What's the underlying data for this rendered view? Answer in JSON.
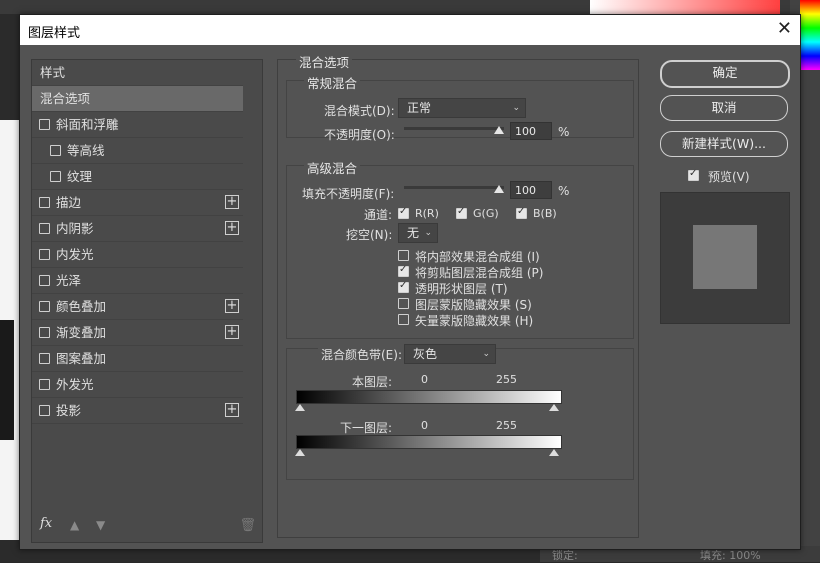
{
  "dialog": {
    "title": "图层样式",
    "close_icon": "close-icon"
  },
  "styles_list": {
    "items": [
      {
        "label": "样式",
        "checkbox": false,
        "plus": false,
        "selected": false
      },
      {
        "label": "混合选项",
        "checkbox": false,
        "plus": false,
        "selected": true
      },
      {
        "label": "斜面和浮雕",
        "checkbox": true,
        "plus": false,
        "selected": false
      },
      {
        "label": "等高线",
        "checkbox": true,
        "plus": false,
        "selected": false,
        "indent": true
      },
      {
        "label": "纹理",
        "checkbox": true,
        "plus": false,
        "selected": false,
        "indent": true
      },
      {
        "label": "描边",
        "checkbox": true,
        "plus": true,
        "selected": false
      },
      {
        "label": "内阴影",
        "checkbox": true,
        "plus": true,
        "selected": false
      },
      {
        "label": "内发光",
        "checkbox": true,
        "plus": false,
        "selected": false
      },
      {
        "label": "光泽",
        "checkbox": true,
        "plus": false,
        "selected": false
      },
      {
        "label": "颜色叠加",
        "checkbox": true,
        "plus": true,
        "selected": false
      },
      {
        "label": "渐变叠加",
        "checkbox": true,
        "plus": true,
        "selected": false
      },
      {
        "label": "图案叠加",
        "checkbox": true,
        "plus": false,
        "selected": false
      },
      {
        "label": "外发光",
        "checkbox": true,
        "plus": false,
        "selected": false
      },
      {
        "label": "投影",
        "checkbox": true,
        "plus": true,
        "selected": false
      }
    ],
    "fx_label": "fx"
  },
  "blend_options": {
    "section_title": "混合选项",
    "general": {
      "title": "常规混合",
      "blend_mode_label": "混合模式(D):",
      "blend_mode_value": "正常",
      "opacity_label": "不透明度(O):",
      "opacity_value": "100",
      "opacity_unit": "%"
    },
    "advanced": {
      "title": "高级混合",
      "fill_opacity_label": "填充不透明度(F):",
      "fill_opacity_value": "100",
      "fill_opacity_unit": "%",
      "channels_label": "通道:",
      "channels": [
        {
          "label": "R(R)",
          "checked": true
        },
        {
          "label": "G(G)",
          "checked": true
        },
        {
          "label": "B(B)",
          "checked": true
        }
      ],
      "knockout_label": "挖空(N):",
      "knockout_value": "无",
      "options": [
        {
          "label": "将内部效果混合成组 (I)",
          "checked": false
        },
        {
          "label": "将剪贴图层混合成组 (P)",
          "checked": true
        },
        {
          "label": "透明形状图层 (T)",
          "checked": true
        },
        {
          "label": "图层蒙版隐藏效果 (S)",
          "checked": false
        },
        {
          "label": "矢量蒙版隐藏效果 (H)",
          "checked": false
        }
      ]
    },
    "blend_if": {
      "label": "混合颜色带(E):",
      "value": "灰色",
      "this_layer_label": "本图层:",
      "this_layer_min": "0",
      "this_layer_max": "255",
      "underlying_label": "下一图层:",
      "underlying_min": "0",
      "underlying_max": "255"
    }
  },
  "buttons": {
    "ok": "确定",
    "cancel": "取消",
    "new_style": "新建样式(W)...",
    "preview_label": "预览(V)",
    "preview_checked": true
  },
  "background": {
    "bottom_lock": "锁定:",
    "bottom_fill": "填充: 100%"
  }
}
